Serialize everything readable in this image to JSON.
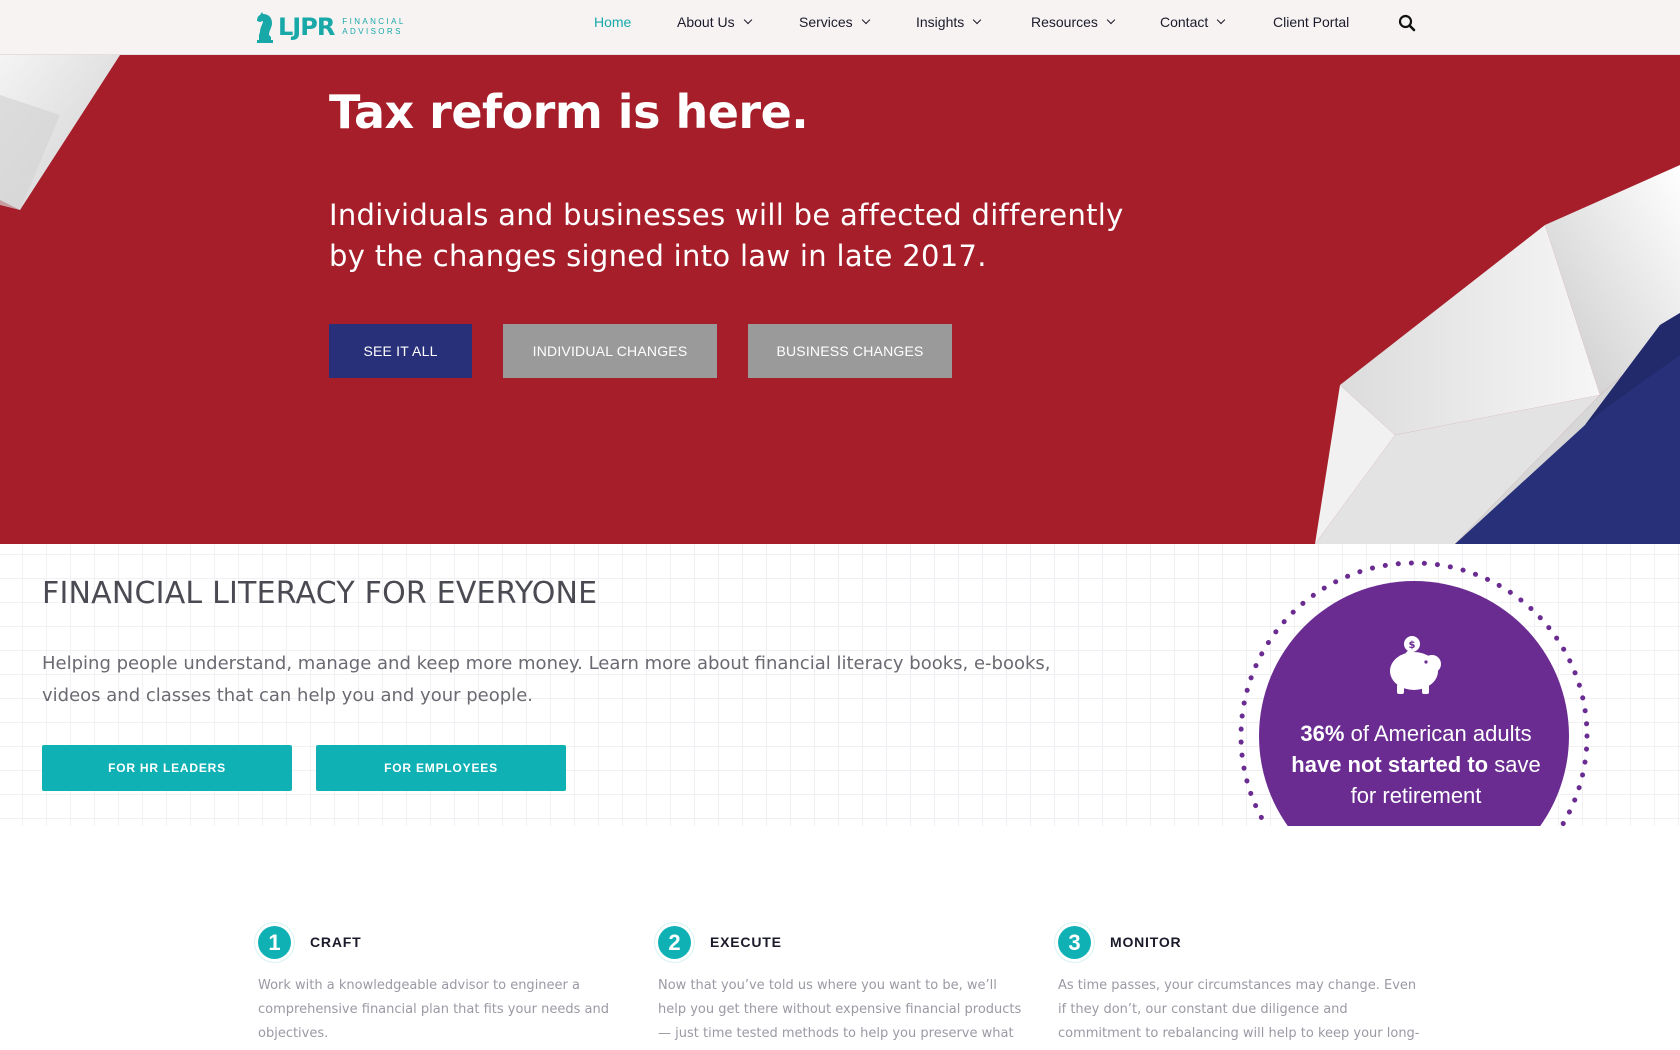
{
  "header": {
    "logo": {
      "mark": "LJPR",
      "line1": "FINANCIAL",
      "line2": "ADVISORS"
    },
    "nav": [
      {
        "label": "Home",
        "active": true,
        "dropdown": false
      },
      {
        "label": "About Us",
        "active": false,
        "dropdown": true
      },
      {
        "label": "Services",
        "active": false,
        "dropdown": true
      },
      {
        "label": "Insights",
        "active": false,
        "dropdown": true
      },
      {
        "label": "Resources",
        "active": false,
        "dropdown": true
      },
      {
        "label": "Contact",
        "active": false,
        "dropdown": true
      },
      {
        "label": "Client Portal",
        "active": false,
        "dropdown": false
      }
    ],
    "search_icon": "search-icon"
  },
  "hero": {
    "title": "Tax reform is here.",
    "subtitle": "Individuals and businesses will be affected differently by the changes signed into law in late 2017.",
    "buttons": {
      "see_all": "SEE IT ALL",
      "individual": "INDIVIDUAL CHANGES",
      "business": "BUSINESS CHANGES"
    },
    "colors": {
      "background": "#a61e2a",
      "primary_button": "#28307a",
      "secondary_button": "#9a9a9a"
    }
  },
  "literacy": {
    "title": "FINANCIAL LITERACY FOR EVERYONE",
    "text": "Helping people understand, manage and keep more money. Learn more about financial literacy books, e-books, videos and classes that can help you and your people.",
    "buttons": {
      "hr": "FOR HR LEADERS",
      "employees": "FOR EMPLOYEES"
    },
    "stat": {
      "percent": "36%",
      "part1": " of American adults",
      "bold": "have not started to",
      "part2": " save",
      "part3": "for retirement",
      "icon": "piggy-bank-icon",
      "color": "#6a2c91"
    },
    "accent": "#0fb1b5"
  },
  "steps": [
    {
      "number": "1",
      "title": "CRAFT",
      "text": "Work with a knowledgeable advisor to engineer a comprehensive financial plan that fits your needs and objectives."
    },
    {
      "number": "2",
      "title": "EXECUTE",
      "text": "Now that you’ve told us where you want to be, we’ll help you get there without expensive financial products — just time tested methods to help you preserve what you’ve"
    },
    {
      "number": "3",
      "title": "MONITOR",
      "text": "As time passes, your circumstances may change. Even if they don’t, our constant due diligence and commitment to rebalancing will help to keep your long-term plan on"
    }
  ]
}
